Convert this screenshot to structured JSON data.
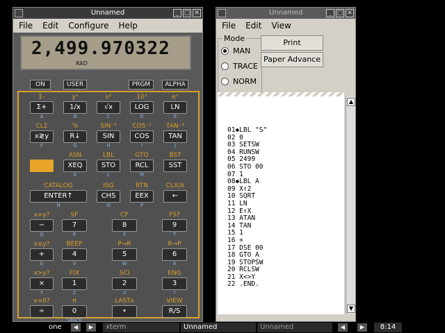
{
  "calc": {
    "title": "Unnamed",
    "menu": [
      "File",
      "Edit",
      "Configure",
      "Help"
    ],
    "display": "2,499.970322",
    "annunciator": "RAD",
    "top_buttons": [
      "ON",
      "USER",
      "PRGM",
      "ALPHA"
    ],
    "rows": [
      [
        {
          "f": "Σ-",
          "k": "Σ+",
          "g": "A"
        },
        {
          "f": "yˣ",
          "k": "1/x",
          "g": "B"
        },
        {
          "f": "x²",
          "k": "√x",
          "g": "C"
        },
        {
          "f": "10ˣ",
          "k": "LOG",
          "g": "D"
        },
        {
          "f": "eˣ",
          "k": "LN",
          "g": "E"
        }
      ],
      [
        {
          "f": "CLΣ",
          "k": "x≷y",
          "g": "F"
        },
        {
          "f": "%",
          "k": "R↓",
          "g": "G"
        },
        {
          "f": "SIN⁻¹",
          "k": "SIN",
          "g": "H"
        },
        {
          "f": "COS⁻¹",
          "k": "COS",
          "g": "I"
        },
        {
          "f": "TAN⁻¹",
          "k": "TAN",
          "g": "J"
        }
      ],
      [
        {
          "f": "",
          "k": "",
          "g": ""
        },
        {
          "f": "ASN",
          "k": "XEQ",
          "g": "K"
        },
        {
          "f": "LBL",
          "k": "STO",
          "g": "L"
        },
        {
          "f": "GTO",
          "k": "RCL",
          "g": "M"
        },
        {
          "f": "BST",
          "k": "SST",
          "g": ""
        }
      ],
      [
        {
          "f": "CATALOG",
          "k": "ENTER↑",
          "g": "N"
        },
        {
          "f": "ISG",
          "k": "CHS",
          "g": "O"
        },
        {
          "f": "RTN",
          "k": "EEX",
          "g": "P"
        },
        {
          "f": "CLX/A",
          "k": "←",
          "g": ""
        }
      ],
      [
        {
          "f": "x=y?",
          "k": "−",
          "g": "Q"
        },
        {
          "f": "SF",
          "k": "7",
          "g": "R"
        },
        {
          "f": "CF",
          "k": "8",
          "g": "S"
        },
        {
          "f": "FS?",
          "k": "9",
          "g": "T"
        }
      ],
      [
        {
          "f": "x≤y?",
          "k": "+",
          "g": "U"
        },
        {
          "f": "BEEP",
          "k": "4",
          "g": "V"
        },
        {
          "f": "P→R",
          "k": "5",
          "g": "W"
        },
        {
          "f": "R→P",
          "k": "6",
          "g": "X"
        }
      ],
      [
        {
          "f": "x>y?",
          "k": "×",
          "g": "Y"
        },
        {
          "f": "FIX",
          "k": "1",
          "g": "Z"
        },
        {
          "f": "SCI",
          "k": "2",
          "g": "="
        },
        {
          "f": "ENG",
          "k": "3",
          "g": "?"
        }
      ],
      [
        {
          "f": "x=0?",
          "k": "÷",
          "g": ":"
        },
        {
          "f": "π",
          "k": "0",
          "g": "SPACE"
        },
        {
          "f": "LASTx",
          "k": "•",
          "g": ","
        },
        {
          "f": "VIEW",
          "k": "R/S",
          "g": ""
        }
      ]
    ]
  },
  "printer": {
    "title": "Unnamed",
    "menu": [
      "File",
      "Edit",
      "View"
    ],
    "mode_label": "Mode",
    "modes": [
      "MAN",
      "TRACE",
      "NORM"
    ],
    "selected_mode": "MAN",
    "print_label": "Print",
    "advance_label": "Paper Advance",
    "lines": [
      "01◆LBL \"S\"",
      "02 0",
      "03 SETSW",
      "04 RUNSW",
      "05 2499",
      "06 STO 00",
      "07 1",
      "08◆LBL A",
      "09 X↑2",
      "10 SQRT",
      "11 LN",
      "12 E↑X",
      "13 ATAN",
      "14 TAN",
      "15 1",
      "16 +",
      "17 DSE 00",
      "18 GTO A",
      "19 STOPSW",
      "20 RCLSW",
      "21 X<>Y",
      "22 .END."
    ]
  },
  "taskbar": {
    "workspace": "one",
    "items": [
      "xterm",
      "Unnamed",
      "Unnamed"
    ],
    "clock": "8:14"
  }
}
